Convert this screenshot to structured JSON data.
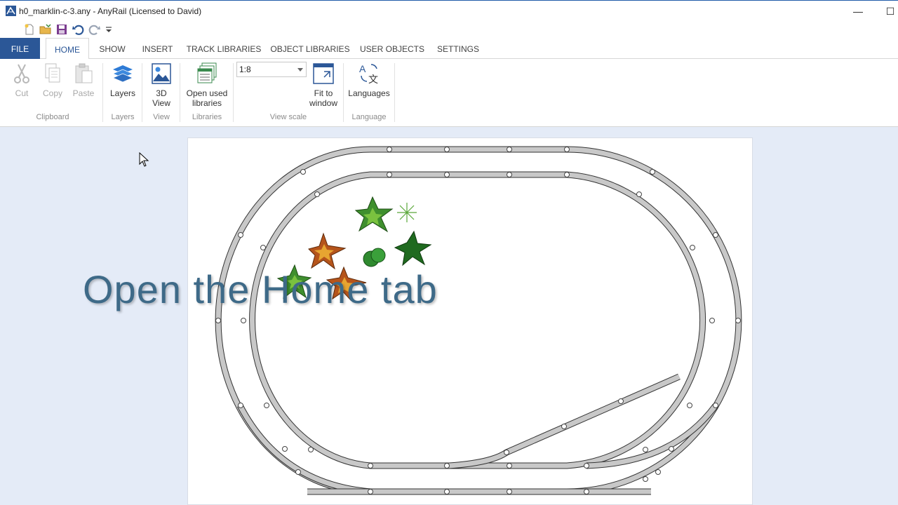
{
  "window": {
    "title": "h0_marklin-c-3.any - AnyRail (Licensed to David)",
    "minimize_glyph": "—",
    "maximize_glyph": "☐"
  },
  "quick_access": [
    "new-icon",
    "open-folder-icon",
    "save-icon",
    "undo-icon",
    "redo-icon",
    "customize-dropdown-icon"
  ],
  "tabs": {
    "file": "FILE",
    "home": "HOME",
    "show": "SHOW",
    "insert": "INSERT",
    "track_libraries": "TRACK LIBRARIES",
    "object_libraries": "OBJECT LIBRARIES",
    "user_objects": "USER OBJECTS",
    "settings": "SETTINGS"
  },
  "ribbon": {
    "clipboard": {
      "cut": "Cut",
      "copy": "Copy",
      "paste": "Paste",
      "label": "Clipboard"
    },
    "layers": {
      "button": "Layers",
      "label": "Layers"
    },
    "view": {
      "button_line1": "3D",
      "button_line2": "View",
      "label": "View"
    },
    "libraries": {
      "button_line1": "Open used",
      "button_line2": "libraries",
      "label": "Libraries"
    },
    "view_scale": {
      "value": "1:8",
      "fit_line1": "Fit to",
      "fit_line2": "window",
      "label": "View scale"
    },
    "language": {
      "button": "Languages",
      "label": "Language"
    }
  },
  "overlay_caption": "Open the Home tab",
  "colors": {
    "file_tab": "#2b5797",
    "canvas_background": "#e4ebf7",
    "caption": "#3e6a88",
    "track_fill": "#c8c8c8"
  }
}
